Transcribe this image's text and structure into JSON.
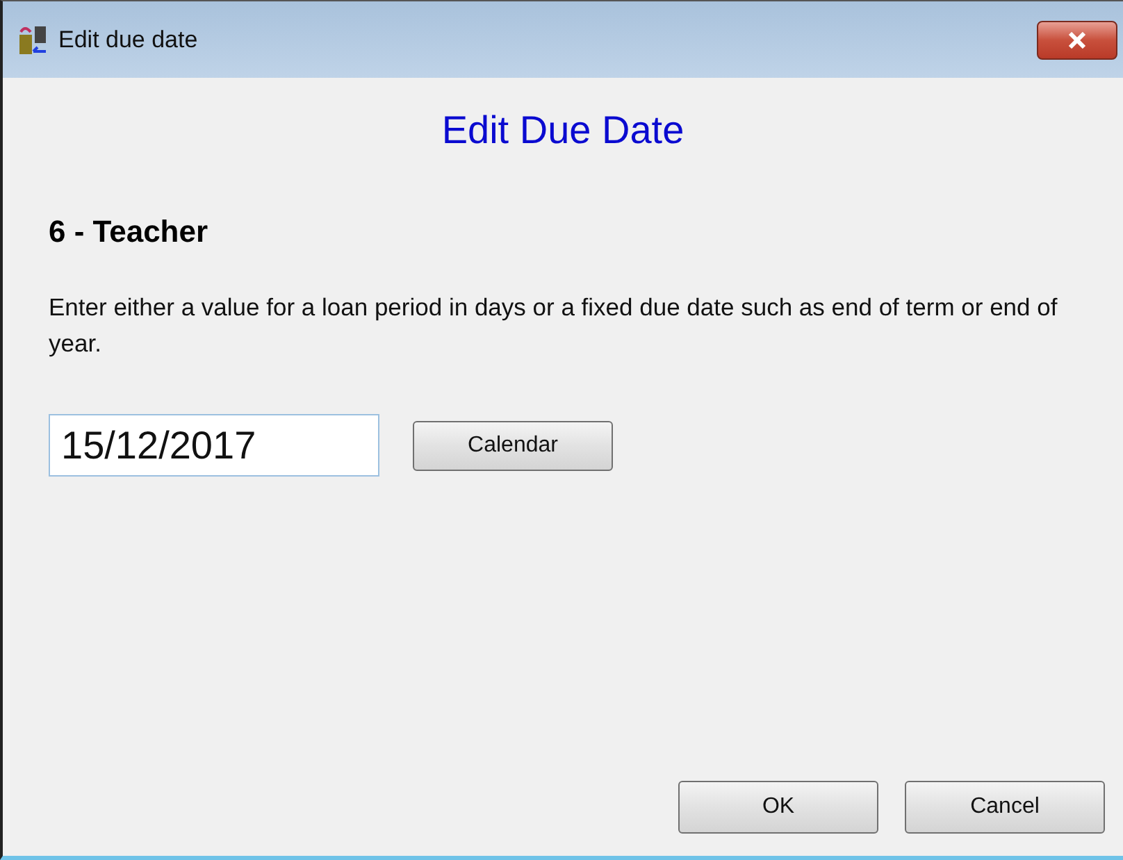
{
  "window": {
    "title": "Edit due date"
  },
  "heading": "Edit Due Date",
  "category": "6 - Teacher",
  "instructions": "Enter either a value for a loan period in days or a fixed due date such as end of term or end of year.",
  "due_date": {
    "value": "15/12/2017"
  },
  "calendar_button": "Calendar",
  "buttons": [
    "OK",
    "Cancel"
  ]
}
